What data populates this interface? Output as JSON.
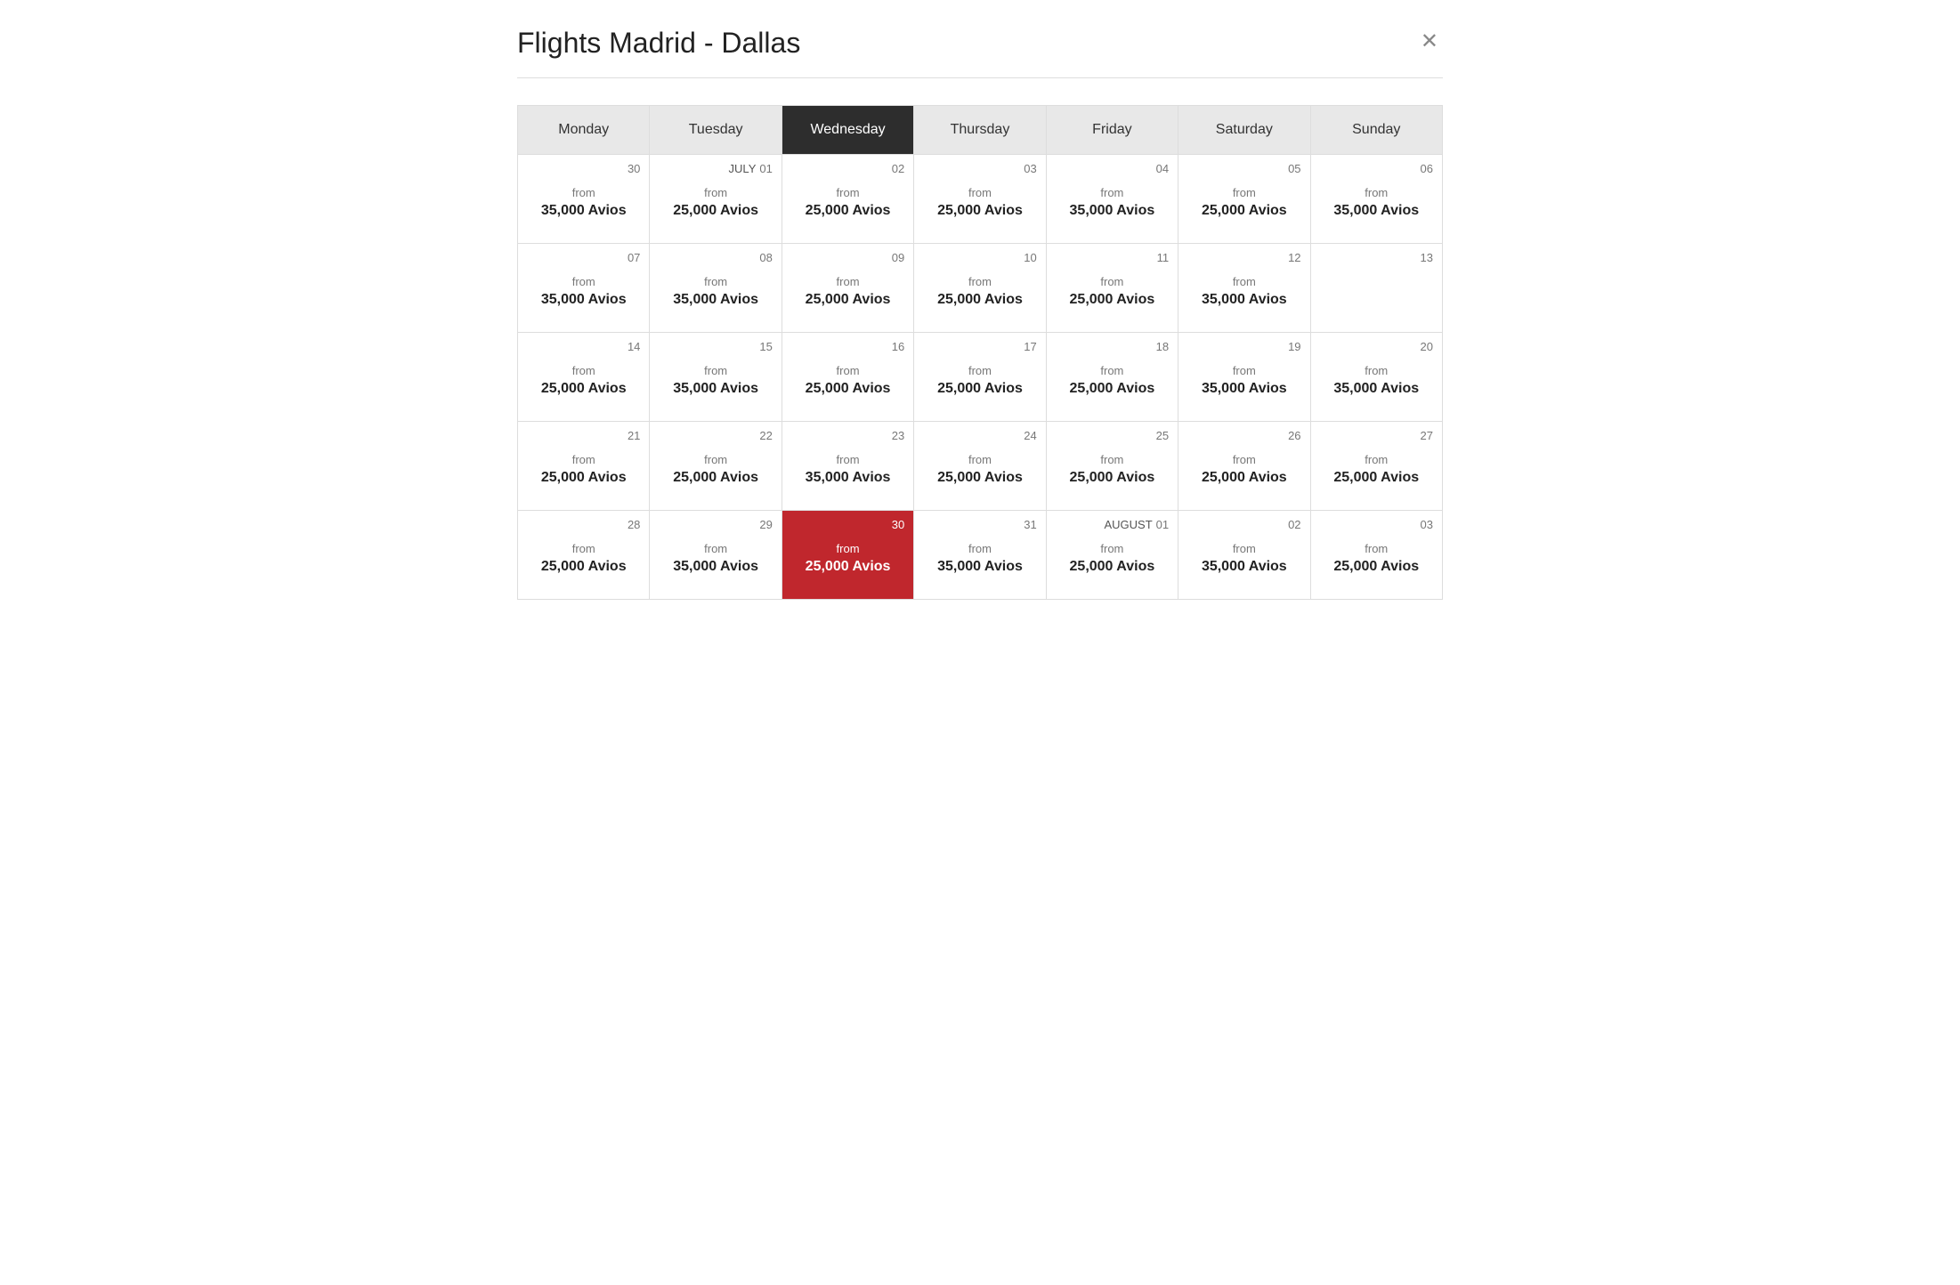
{
  "modal": {
    "title": "Flights Madrid - Dallas",
    "close_label": "✕"
  },
  "days": [
    "Monday",
    "Tuesday",
    "Wednesday",
    "Thursday",
    "Friday",
    "Saturday",
    "Sunday"
  ],
  "active_day_index": 2,
  "weeks": [
    {
      "cells": [
        {
          "date": "30",
          "month_label": "",
          "from": "from",
          "avios": "35,000 Avios",
          "selected": false
        },
        {
          "date": "01",
          "month_label": "JULY",
          "from": "from",
          "avios": "25,000 Avios",
          "selected": false
        },
        {
          "date": "02",
          "month_label": "",
          "from": "from",
          "avios": "25,000 Avios",
          "selected": false
        },
        {
          "date": "03",
          "month_label": "",
          "from": "from",
          "avios": "25,000 Avios",
          "selected": false
        },
        {
          "date": "04",
          "month_label": "",
          "from": "from",
          "avios": "35,000 Avios",
          "selected": false
        },
        {
          "date": "05",
          "month_label": "",
          "from": "from",
          "avios": "25,000 Avios",
          "selected": false
        },
        {
          "date": "06",
          "month_label": "",
          "from": "from",
          "avios": "35,000 Avios",
          "selected": false
        }
      ]
    },
    {
      "cells": [
        {
          "date": "07",
          "month_label": "",
          "from": "from",
          "avios": "35,000 Avios",
          "selected": false
        },
        {
          "date": "08",
          "month_label": "",
          "from": "from",
          "avios": "35,000 Avios",
          "selected": false
        },
        {
          "date": "09",
          "month_label": "",
          "from": "from",
          "avios": "25,000 Avios",
          "selected": false
        },
        {
          "date": "10",
          "month_label": "",
          "from": "from",
          "avios": "25,000 Avios",
          "selected": false
        },
        {
          "date": "11",
          "month_label": "",
          "from": "from",
          "avios": "25,000 Avios",
          "selected": false
        },
        {
          "date": "12",
          "month_label": "",
          "from": "from",
          "avios": "35,000 Avios",
          "selected": false
        },
        {
          "date": "13",
          "month_label": "",
          "from": "",
          "avios": "",
          "selected": false
        }
      ]
    },
    {
      "cells": [
        {
          "date": "14",
          "month_label": "",
          "from": "from",
          "avios": "25,000 Avios",
          "selected": false
        },
        {
          "date": "15",
          "month_label": "",
          "from": "from",
          "avios": "35,000 Avios",
          "selected": false
        },
        {
          "date": "16",
          "month_label": "",
          "from": "from",
          "avios": "25,000 Avios",
          "selected": false
        },
        {
          "date": "17",
          "month_label": "",
          "from": "from",
          "avios": "25,000 Avios",
          "selected": false
        },
        {
          "date": "18",
          "month_label": "",
          "from": "from",
          "avios": "25,000 Avios",
          "selected": false
        },
        {
          "date": "19",
          "month_label": "",
          "from": "from",
          "avios": "35,000 Avios",
          "selected": false
        },
        {
          "date": "20",
          "month_label": "",
          "from": "from",
          "avios": "35,000 Avios",
          "selected": false
        }
      ]
    },
    {
      "cells": [
        {
          "date": "21",
          "month_label": "",
          "from": "from",
          "avios": "25,000 Avios",
          "selected": false
        },
        {
          "date": "22",
          "month_label": "",
          "from": "from",
          "avios": "25,000 Avios",
          "selected": false
        },
        {
          "date": "23",
          "month_label": "",
          "from": "from",
          "avios": "35,000 Avios",
          "selected": false
        },
        {
          "date": "24",
          "month_label": "",
          "from": "from",
          "avios": "25,000 Avios",
          "selected": false
        },
        {
          "date": "25",
          "month_label": "",
          "from": "from",
          "avios": "25,000 Avios",
          "selected": false
        },
        {
          "date": "26",
          "month_label": "",
          "from": "from",
          "avios": "25,000 Avios",
          "selected": false
        },
        {
          "date": "27",
          "month_label": "",
          "from": "from",
          "avios": "25,000 Avios",
          "selected": false
        }
      ]
    },
    {
      "cells": [
        {
          "date": "28",
          "month_label": "",
          "from": "from",
          "avios": "25,000 Avios",
          "selected": false
        },
        {
          "date": "29",
          "month_label": "",
          "from": "from",
          "avios": "35,000 Avios",
          "selected": false
        },
        {
          "date": "30",
          "month_label": "",
          "from": "from",
          "avios": "25,000 Avios",
          "selected": true
        },
        {
          "date": "31",
          "month_label": "",
          "from": "from",
          "avios": "35,000 Avios",
          "selected": false
        },
        {
          "date": "01",
          "month_label": "AUGUST",
          "from": "from",
          "avios": "25,000 Avios",
          "selected": false
        },
        {
          "date": "02",
          "month_label": "",
          "from": "from",
          "avios": "35,000 Avios",
          "selected": false
        },
        {
          "date": "03",
          "month_label": "",
          "from": "from",
          "avios": "25,000 Avios",
          "selected": false
        }
      ]
    }
  ]
}
